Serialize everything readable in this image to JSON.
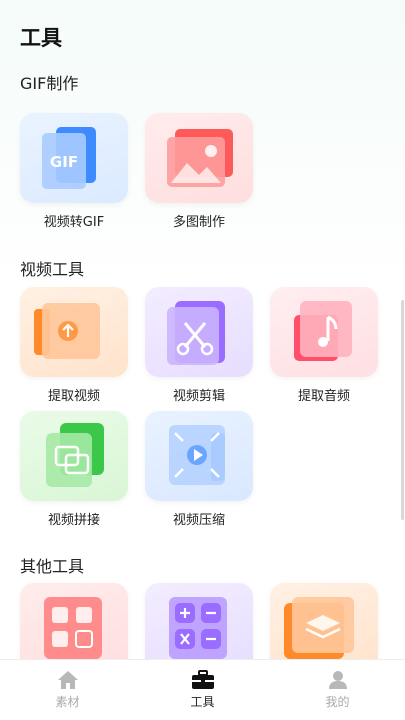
{
  "header": {
    "title": "工具"
  },
  "sections": [
    {
      "title": "GIF制作"
    },
    {
      "title": "视频工具"
    },
    {
      "title": "其他工具"
    }
  ],
  "gif_tools": [
    {
      "label": "视频转GIF",
      "icon": "gif-file-icon"
    },
    {
      "label": "多图制作",
      "icon": "multi-image-icon"
    }
  ],
  "video_tools": [
    {
      "label": "提取视频",
      "icon": "extract-video-icon"
    },
    {
      "label": "视频剪辑",
      "icon": "scissors-icon"
    },
    {
      "label": "提取音频",
      "icon": "music-note-icon"
    },
    {
      "label": "视频拼接",
      "icon": "merge-icon"
    },
    {
      "label": "视频压缩",
      "icon": "compress-icon"
    }
  ],
  "other_tools": [
    {
      "icon": "grid-qr-icon"
    },
    {
      "icon": "calculator-icon"
    },
    {
      "icon": "layers-icon"
    }
  ],
  "tabbar": {
    "items": [
      {
        "label": "素材",
        "icon": "home-icon",
        "active": false
      },
      {
        "label": "工具",
        "icon": "toolbox-icon",
        "active": true
      },
      {
        "label": "我的",
        "icon": "user-icon",
        "active": false
      }
    ]
  },
  "colors": {
    "blue": "#3d8bff",
    "red": "#ff5a5a",
    "orange": "#ff8a2a",
    "purple": "#9a6cff",
    "pink": "#ff4f6a",
    "green": "#3bc84a"
  }
}
